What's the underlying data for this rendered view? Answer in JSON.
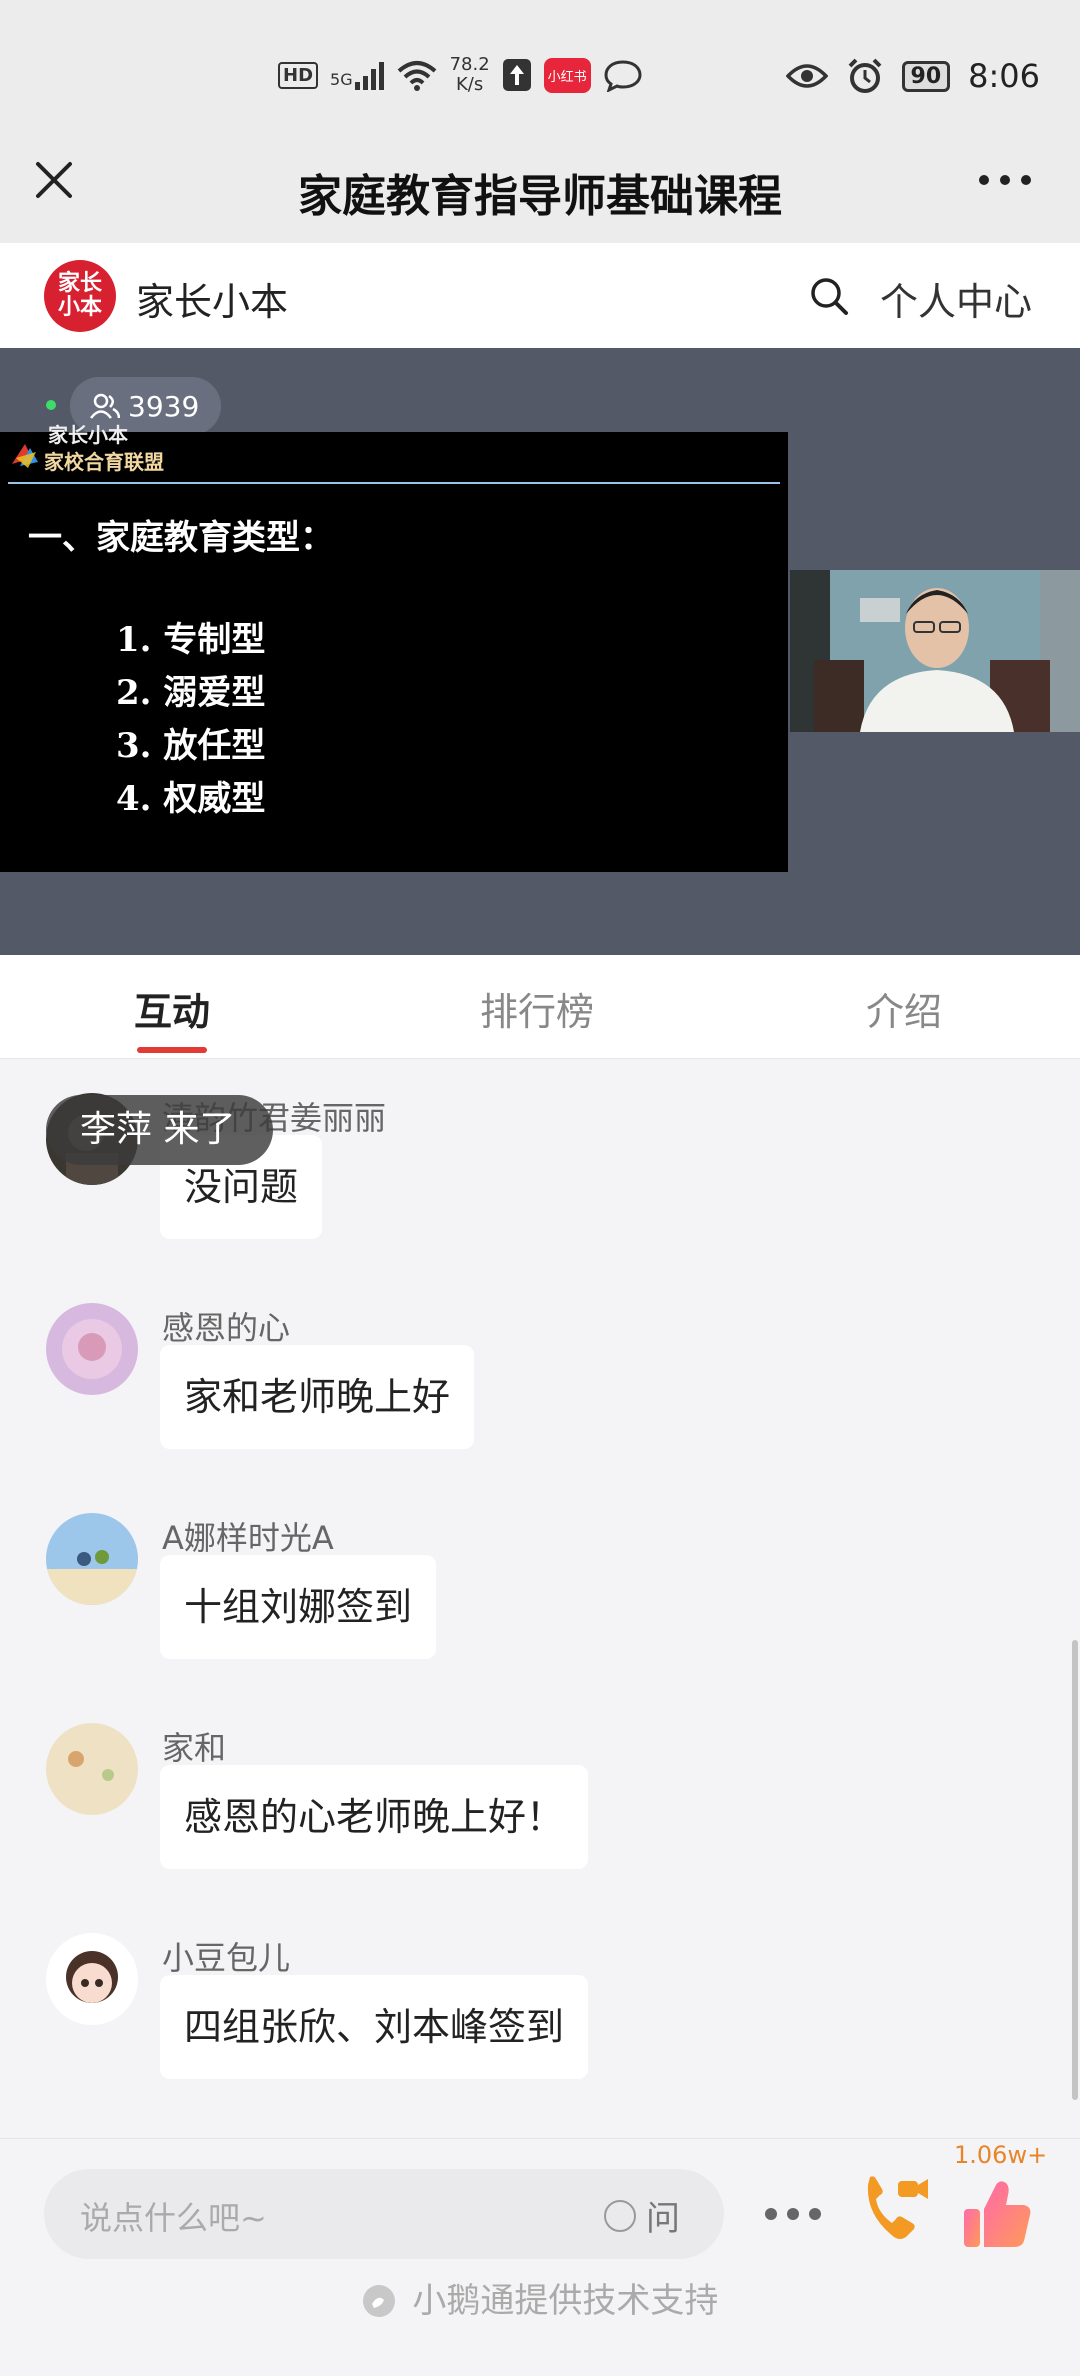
{
  "status_bar": {
    "hd": "HD",
    "network": "5G",
    "speed_value": "78.2",
    "speed_unit": "K/s",
    "app_chip": "小红书",
    "battery": "90",
    "time": "8:06"
  },
  "titlebar": {
    "title": "家庭教育指导师基础课程"
  },
  "brandbar": {
    "logo_text": "家长小本",
    "name": "家长小本",
    "personal_center": "个人中心"
  },
  "video": {
    "viewer_count": "3939",
    "watermark": "家长小本",
    "slide": {
      "org": "家校合育联盟",
      "heading": "一、家庭教育类型：",
      "items": [
        "1. 专制型",
        "2. 溺爱型",
        "3. 放任型",
        "4. 权威型"
      ]
    }
  },
  "tabs": [
    {
      "label": "互动",
      "active": true
    },
    {
      "label": "排行榜",
      "active": false
    },
    {
      "label": "介绍",
      "active": false
    }
  ],
  "toast": "李萍 来了",
  "messages": [
    {
      "user": "清韵竹君姜丽丽",
      "text": "没问题"
    },
    {
      "user": "感恩的心",
      "text": "家和老师晚上好"
    },
    {
      "user": "A娜样时光A",
      "text": "十组刘娜签到"
    },
    {
      "user": "家和",
      "text": "感恩的心老师晚上好！"
    },
    {
      "user": "小豆包儿",
      "text": "四组张欣、刘本峰签到"
    }
  ],
  "bottom": {
    "input_placeholder": "说点什么吧~",
    "ask_label": "问",
    "like_count": "1.06w+",
    "support_text": "小鹅通提供技术支持"
  },
  "colors": {
    "accent": "#e23a34",
    "like": "#f2a23a",
    "call": "#f29a24"
  }
}
